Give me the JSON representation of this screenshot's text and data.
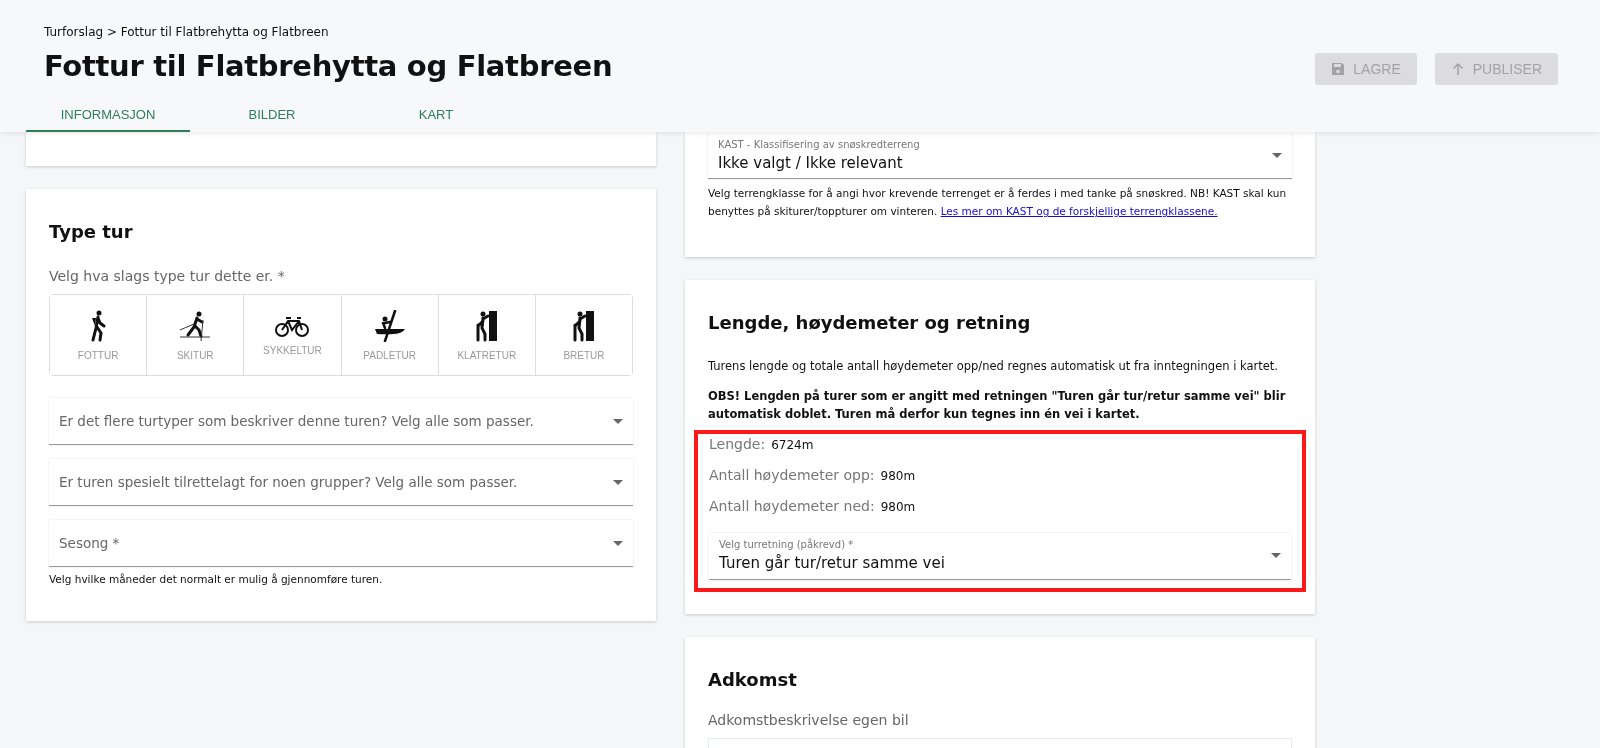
{
  "breadcrumb": "Turforslag > Fottur til Flatbrehytta og Flatbreen",
  "title": "Fottur til Flatbrehytta og Flatbreen",
  "actions": [
    {
      "label": "LAGRE",
      "kind": "save",
      "disabled": true
    },
    {
      "label": "PUBLISER",
      "kind": "publish",
      "disabled": true
    }
  ],
  "tabs": [
    {
      "label": "INFORMASJON",
      "selected": true
    },
    {
      "label": "BILDER",
      "selected": false
    },
    {
      "label": "KART",
      "selected": false
    }
  ],
  "trip_type_card": {
    "heading": "Type tur",
    "prompt": "Velg hva slags type tur dette er. *",
    "types": [
      {
        "label": "FOTTUR",
        "kind": "hiking",
        "selected": false
      },
      {
        "label": "SKITUR",
        "kind": "skiing",
        "selected": false
      },
      {
        "label": "SYKKELTUR",
        "kind": "cycling",
        "selected": false
      },
      {
        "label": "PADLETUR",
        "kind": "paddling",
        "selected": false
      },
      {
        "label": "KLATRETUR",
        "kind": "climbing",
        "selected": false
      },
      {
        "label": "BRETUR",
        "kind": "climbing",
        "selected": false
      }
    ],
    "selects": [
      {
        "placeholder": "Er det flere turtyper som beskriver denne turen? Velg alle som passer."
      },
      {
        "placeholder": "Er turen spesielt tilrettelagt for noen grupper? Velg alle som passer."
      },
      {
        "placeholder": "Sesong *",
        "helper": "Velg hvilke måneder det normalt er mulig å gjennomføre turen."
      }
    ]
  },
  "kast_card": {
    "label": "KAST - Klassifisering av snøskredterreng",
    "value": "Ikke valgt / Ikke relevant",
    "help": "Velg terrengklasse for å angi hvor krevende terrenget er å ferdes i med tanke på snøskred. NB! KAST skal kun benyttes på skiturer/toppturer om vinteren.",
    "link": "Les mer om KAST og de forskjellige terrengklassene."
  },
  "length_card": {
    "heading": "Lengde, høydemeter og retning",
    "info": "Turens lengde og totale antall høydemeter opp/ned regnes automatisk ut fra inntegningen i kartet.",
    "warning": "OBS! Lengden på turer som er angitt med retningen \"Turen går tur/retur samme vei\" blir automatisk doblet. Turen må derfor kun tegnes inn én vei i kartet.",
    "highlighted": true,
    "stats": [
      {
        "label": "Lengde:",
        "value": "6724m"
      },
      {
        "label": "Antall høydemeter opp:",
        "value": "980m"
      },
      {
        "label": "Antall høydemeter ned:",
        "value": "980m"
      }
    ],
    "direction": {
      "label": "Velg turretning (påkrevd) *",
      "value": "Turen går tur/retur samme vei"
    }
  },
  "access_card": {
    "heading": "Adkomst",
    "field_label": "Adkomstbeskrivelse egen bil"
  }
}
